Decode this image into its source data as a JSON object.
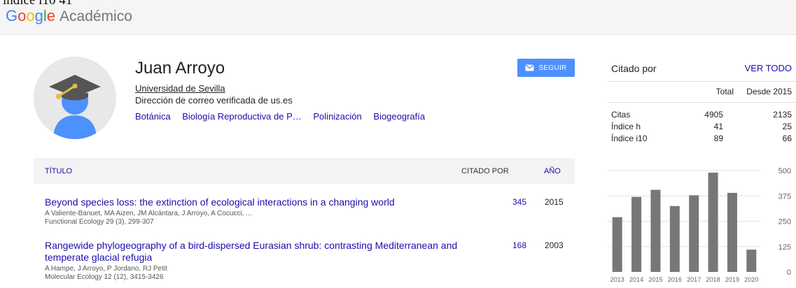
{
  "clip_text": "indice i10 41",
  "logo": {
    "brand": "Google",
    "product": "Académico"
  },
  "profile": {
    "name": "Juan Arroyo",
    "affiliation": "Universidad de Sevilla",
    "email_note": "Dirección de correo verificada de us.es",
    "interests": [
      "Botánica",
      "Biología Reproductiva de P…",
      "Polinización",
      "Biogeografía"
    ],
    "follow_label": "SEGUIR"
  },
  "table": {
    "headers": {
      "title": "TÍTULO",
      "cited_by": "CITADO POR",
      "year": "AÑO"
    },
    "rows": [
      {
        "title": "Beyond species loss: the extinction of ecological interactions in a changing world",
        "authors": "A Valiente-Banuet, MA Aizen, JM Alcántara, J Arroyo, A Cocucci, ...",
        "venue": "Functional Ecology 29 (3), 299-307",
        "cited_by": "345",
        "year": "2015"
      },
      {
        "title": "Rangewide phylogeography of a bird-dispersed Eurasian shrub: contrasting Mediterranean and temperate glacial refugia",
        "authors": "A Hampe, J Arroyo, P Jordano, RJ Petit",
        "venue": "Molecular Ecology 12 (12), 3415-3426",
        "cited_by": "168",
        "year": "2003"
      }
    ]
  },
  "citations": {
    "title": "Citado por",
    "view_all": "VER TODO",
    "columns": {
      "total": "Total",
      "since": "Desde 2015"
    },
    "rows": [
      {
        "label": "Citas",
        "total": "4905",
        "since": "2135"
      },
      {
        "label": "Índice h",
        "total": "41",
        "since": "25"
      },
      {
        "label": "Índice i10",
        "total": "89",
        "since": "66"
      }
    ]
  },
  "colors": {
    "accent": "#4d90fe",
    "link": "#1a0dab",
    "bar": "#777777"
  },
  "chart_data": {
    "type": "bar",
    "categories": [
      "2013",
      "2014",
      "2015",
      "2016",
      "2017",
      "2018",
      "2019",
      "2020"
    ],
    "values": [
      270,
      370,
      405,
      325,
      378,
      490,
      390,
      110
    ],
    "y_ticks": [
      "500",
      "375",
      "250",
      "125",
      "0"
    ],
    "ylim": [
      0,
      500
    ],
    "grid": true
  }
}
